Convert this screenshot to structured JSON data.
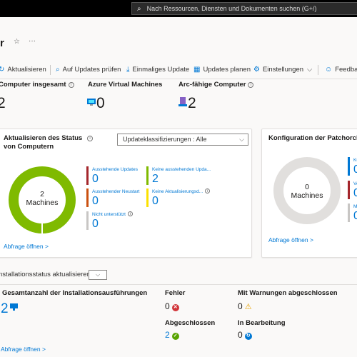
{
  "search": {
    "placeholder": "Nach Ressourcen, Diensten und Dokumenten suchen (G+/)"
  },
  "header": {
    "title": "r",
    "more": "···"
  },
  "toolbar": {
    "refresh": "Aktualisieren",
    "check_updates": "Auf Updates prüfen",
    "one_time_update": "Einmaliges Update",
    "schedule_updates": "Updates planen",
    "settings": "Einstellungen",
    "feedback": "Feedbac"
  },
  "kpis": {
    "total_label": "Computer insgesamt",
    "total_value": "2",
    "azure_label": "Azure Virtual Machines",
    "azure_value": "0",
    "arc_label": "Arc-fähige Computer",
    "arc_value": "2"
  },
  "status_card": {
    "title_line1": "Aktualisieren des Status",
    "title_line2": "von Computern",
    "dropdown_value": "Updateklassifizierungen : Alle",
    "donut_value": "2",
    "donut_unit": "Machines",
    "legend": [
      {
        "label": "Ausstehende Updates",
        "value": "0",
        "color": "#a4262c"
      },
      {
        "label": "Keine ausstehenden Upda...",
        "value": "2",
        "color": "#7fba00"
      },
      {
        "label": "Ausstehender Neustart",
        "value": "0",
        "color": "#ca5010"
      },
      {
        "label": "Keine Aktualisierungsd...",
        "value": "0",
        "color": "#fce100"
      },
      {
        "label": "Nicht unterstützt",
        "value": "0",
        "color": "#c8c6c4"
      }
    ],
    "link": "Abfrage öffnen >"
  },
  "patch_card": {
    "title": "Konfiguration der Patchorche",
    "donut_value": "0",
    "donut_unit": "Machines",
    "legend": [
      {
        "label": "Ku",
        "value": "0",
        "color": "#0078d4"
      },
      {
        "label": "Vo",
        "value": "0",
        "color": "#a4262c"
      },
      {
        "label": "M",
        "value": "0",
        "color": "#c8c6c4"
      }
    ],
    "link": "Abfrage öffnen >"
  },
  "install_section": {
    "title": "nstallationsstatus aktualisieren",
    "total_label": "Gesamtanzahl der Installationsausführungen",
    "total_value": "2",
    "errors_label": "Fehler",
    "errors_value": "0",
    "warnings_label": "Mit Warnungen abgeschlossen",
    "warnings_value": "0",
    "completed_label": "Abgeschlossen",
    "completed_value": "2",
    "in_progress_label": "In Bearbeitung",
    "in_progress_value": "0",
    "link": "Abfrage öffnen >"
  },
  "colors": {
    "accent": "#0078d4",
    "green": "#7fba00",
    "grey": "#e1dfdd"
  }
}
